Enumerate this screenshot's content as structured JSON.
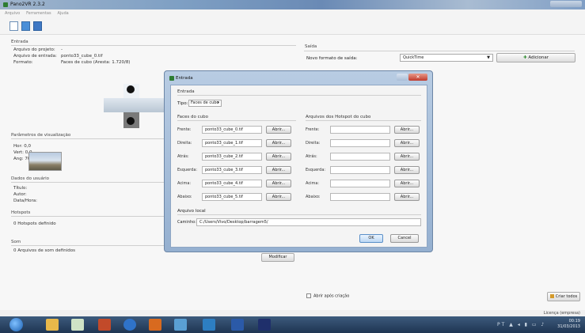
{
  "window": {
    "title": "Pano2VR 2.3.2"
  },
  "menu": {
    "items": [
      "Arquivo",
      "Ferramentas",
      "Ajuda"
    ]
  },
  "toolbar": {
    "icons": [
      "new-file-icon",
      "open-file-icon",
      "save-icon"
    ]
  },
  "entrada": {
    "title": "Entrada",
    "project_label": "Arquivo do projeto:",
    "project_value": "-",
    "input_label": "Arquivo de entrada:",
    "input_value": "ponto33_cube_0.tif",
    "format_label": "Formato:",
    "format_value": "Faces de cubo (Aresta: 1.720/8)"
  },
  "view_params": {
    "title": "Parâmetros de visualização",
    "pan": "Hor:  0,0",
    "tilt": "Vert:  0,0",
    "fov": "Ang:  70,0"
  },
  "user_data": {
    "title": "Dados do usuário",
    "t1": "Título:",
    "t2": "Autor:",
    "t3": "Data/Hora:"
  },
  "hotspots": {
    "title": "Hotspots",
    "text": "0 Hotspots definido"
  },
  "sound": {
    "title": "Som",
    "text": "0 Arquivos de som definidos"
  },
  "modify_button": "Modificar",
  "saida": {
    "title": "Saída",
    "new_format_label": "Novo formato de saída:",
    "format_selected": "QuickTime",
    "add_button": "Adicionar",
    "open_after": "Abrir após criação",
    "create_button": "Criar todos"
  },
  "status": {
    "text": "Licença (empresa)"
  },
  "clock": {
    "time": "00:19",
    "date": "31/03/2013",
    "lang": "PT"
  },
  "dialog": {
    "title": "Entrada",
    "section_title": "Entrada",
    "type_label": "Tipo:",
    "type_value": "Faces de cubo",
    "faces_title": "Faces do cubo",
    "hotspot_title": "Arquivos dos Hotspot do cubo",
    "browse_label": "Abrir...",
    "faces": [
      {
        "label": "Frente:",
        "value": "ponto33_cube_0.tif"
      },
      {
        "label": "Direita:",
        "value": "ponto33_cube_1.tif"
      },
      {
        "label": "Atrás:",
        "value": "ponto33_cube_2.tif"
      },
      {
        "label": "Esquerda:",
        "value": "ponto33_cube_3.tif"
      },
      {
        "label": "Acima:",
        "value": "ponto33_cube_4.tif"
      },
      {
        "label": "Abaixo:",
        "value": "ponto33_cube_5.tif"
      }
    ],
    "hotspot_faces": [
      "Frente:",
      "Direita:",
      "Atrás:",
      "Esquerda:",
      "Acima:",
      "Abaixo:"
    ],
    "local_title": "Arquivo local",
    "path_label": "Caminho:",
    "path_value": "C:/Users/Vivo/Desktop/barragem5/",
    "ok_button": "OK",
    "cancel_button": "Cancel"
  }
}
